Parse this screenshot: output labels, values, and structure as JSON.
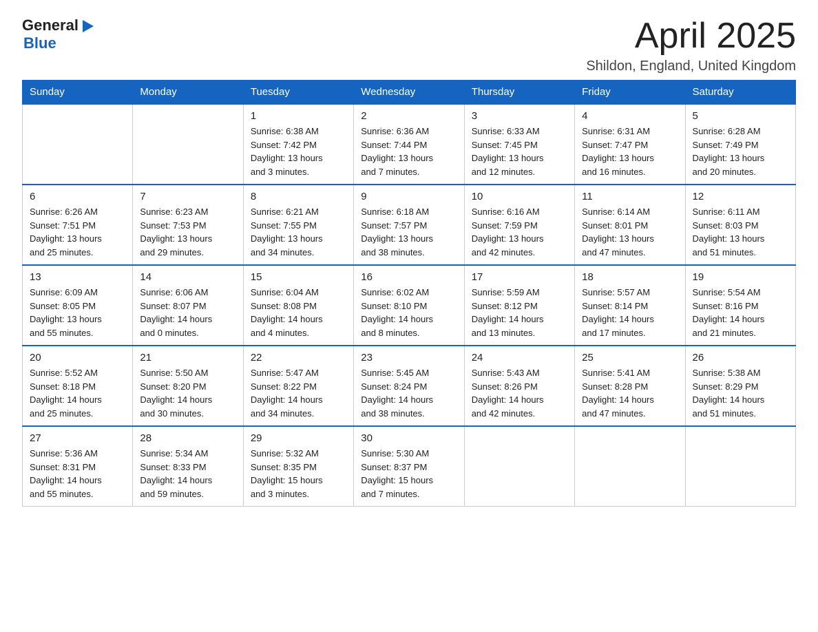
{
  "header": {
    "logo_general": "General",
    "logo_blue": "Blue",
    "month_title": "April 2025",
    "location": "Shildon, England, United Kingdom"
  },
  "weekdays": [
    "Sunday",
    "Monday",
    "Tuesday",
    "Wednesday",
    "Thursday",
    "Friday",
    "Saturday"
  ],
  "weeks": [
    [
      {
        "day": "",
        "info": ""
      },
      {
        "day": "",
        "info": ""
      },
      {
        "day": "1",
        "info": "Sunrise: 6:38 AM\nSunset: 7:42 PM\nDaylight: 13 hours\nand 3 minutes."
      },
      {
        "day": "2",
        "info": "Sunrise: 6:36 AM\nSunset: 7:44 PM\nDaylight: 13 hours\nand 7 minutes."
      },
      {
        "day": "3",
        "info": "Sunrise: 6:33 AM\nSunset: 7:45 PM\nDaylight: 13 hours\nand 12 minutes."
      },
      {
        "day": "4",
        "info": "Sunrise: 6:31 AM\nSunset: 7:47 PM\nDaylight: 13 hours\nand 16 minutes."
      },
      {
        "day": "5",
        "info": "Sunrise: 6:28 AM\nSunset: 7:49 PM\nDaylight: 13 hours\nand 20 minutes."
      }
    ],
    [
      {
        "day": "6",
        "info": "Sunrise: 6:26 AM\nSunset: 7:51 PM\nDaylight: 13 hours\nand 25 minutes."
      },
      {
        "day": "7",
        "info": "Sunrise: 6:23 AM\nSunset: 7:53 PM\nDaylight: 13 hours\nand 29 minutes."
      },
      {
        "day": "8",
        "info": "Sunrise: 6:21 AM\nSunset: 7:55 PM\nDaylight: 13 hours\nand 34 minutes."
      },
      {
        "day": "9",
        "info": "Sunrise: 6:18 AM\nSunset: 7:57 PM\nDaylight: 13 hours\nand 38 minutes."
      },
      {
        "day": "10",
        "info": "Sunrise: 6:16 AM\nSunset: 7:59 PM\nDaylight: 13 hours\nand 42 minutes."
      },
      {
        "day": "11",
        "info": "Sunrise: 6:14 AM\nSunset: 8:01 PM\nDaylight: 13 hours\nand 47 minutes."
      },
      {
        "day": "12",
        "info": "Sunrise: 6:11 AM\nSunset: 8:03 PM\nDaylight: 13 hours\nand 51 minutes."
      }
    ],
    [
      {
        "day": "13",
        "info": "Sunrise: 6:09 AM\nSunset: 8:05 PM\nDaylight: 13 hours\nand 55 minutes."
      },
      {
        "day": "14",
        "info": "Sunrise: 6:06 AM\nSunset: 8:07 PM\nDaylight: 14 hours\nand 0 minutes."
      },
      {
        "day": "15",
        "info": "Sunrise: 6:04 AM\nSunset: 8:08 PM\nDaylight: 14 hours\nand 4 minutes."
      },
      {
        "day": "16",
        "info": "Sunrise: 6:02 AM\nSunset: 8:10 PM\nDaylight: 14 hours\nand 8 minutes."
      },
      {
        "day": "17",
        "info": "Sunrise: 5:59 AM\nSunset: 8:12 PM\nDaylight: 14 hours\nand 13 minutes."
      },
      {
        "day": "18",
        "info": "Sunrise: 5:57 AM\nSunset: 8:14 PM\nDaylight: 14 hours\nand 17 minutes."
      },
      {
        "day": "19",
        "info": "Sunrise: 5:54 AM\nSunset: 8:16 PM\nDaylight: 14 hours\nand 21 minutes."
      }
    ],
    [
      {
        "day": "20",
        "info": "Sunrise: 5:52 AM\nSunset: 8:18 PM\nDaylight: 14 hours\nand 25 minutes."
      },
      {
        "day": "21",
        "info": "Sunrise: 5:50 AM\nSunset: 8:20 PM\nDaylight: 14 hours\nand 30 minutes."
      },
      {
        "day": "22",
        "info": "Sunrise: 5:47 AM\nSunset: 8:22 PM\nDaylight: 14 hours\nand 34 minutes."
      },
      {
        "day": "23",
        "info": "Sunrise: 5:45 AM\nSunset: 8:24 PM\nDaylight: 14 hours\nand 38 minutes."
      },
      {
        "day": "24",
        "info": "Sunrise: 5:43 AM\nSunset: 8:26 PM\nDaylight: 14 hours\nand 42 minutes."
      },
      {
        "day": "25",
        "info": "Sunrise: 5:41 AM\nSunset: 8:28 PM\nDaylight: 14 hours\nand 47 minutes."
      },
      {
        "day": "26",
        "info": "Sunrise: 5:38 AM\nSunset: 8:29 PM\nDaylight: 14 hours\nand 51 minutes."
      }
    ],
    [
      {
        "day": "27",
        "info": "Sunrise: 5:36 AM\nSunset: 8:31 PM\nDaylight: 14 hours\nand 55 minutes."
      },
      {
        "day": "28",
        "info": "Sunrise: 5:34 AM\nSunset: 8:33 PM\nDaylight: 14 hours\nand 59 minutes."
      },
      {
        "day": "29",
        "info": "Sunrise: 5:32 AM\nSunset: 8:35 PM\nDaylight: 15 hours\nand 3 minutes."
      },
      {
        "day": "30",
        "info": "Sunrise: 5:30 AM\nSunset: 8:37 PM\nDaylight: 15 hours\nand 7 minutes."
      },
      {
        "day": "",
        "info": ""
      },
      {
        "day": "",
        "info": ""
      },
      {
        "day": "",
        "info": ""
      }
    ]
  ]
}
